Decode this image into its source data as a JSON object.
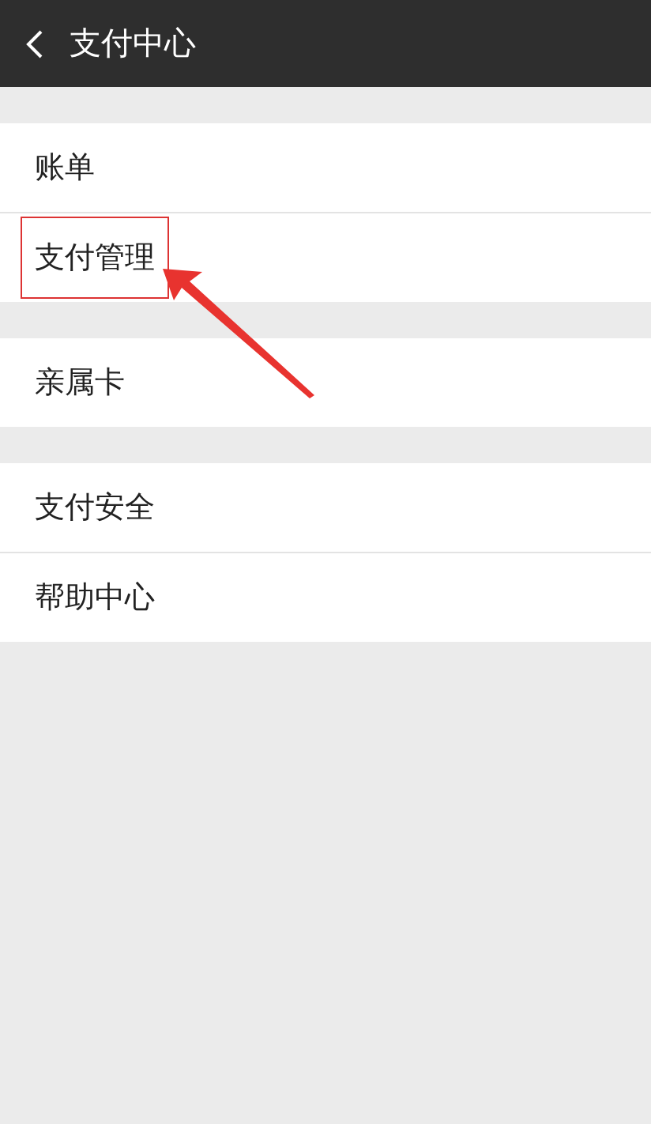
{
  "header": {
    "title": "支付中心"
  },
  "groups": [
    {
      "items": [
        {
          "label": "账单",
          "highlighted": false
        },
        {
          "label": "支付管理",
          "highlighted": true
        }
      ]
    },
    {
      "items": [
        {
          "label": "亲属卡",
          "highlighted": false
        }
      ]
    },
    {
      "items": [
        {
          "label": "支付安全",
          "highlighted": false
        },
        {
          "label": "帮助中心",
          "highlighted": false
        }
      ]
    }
  ]
}
